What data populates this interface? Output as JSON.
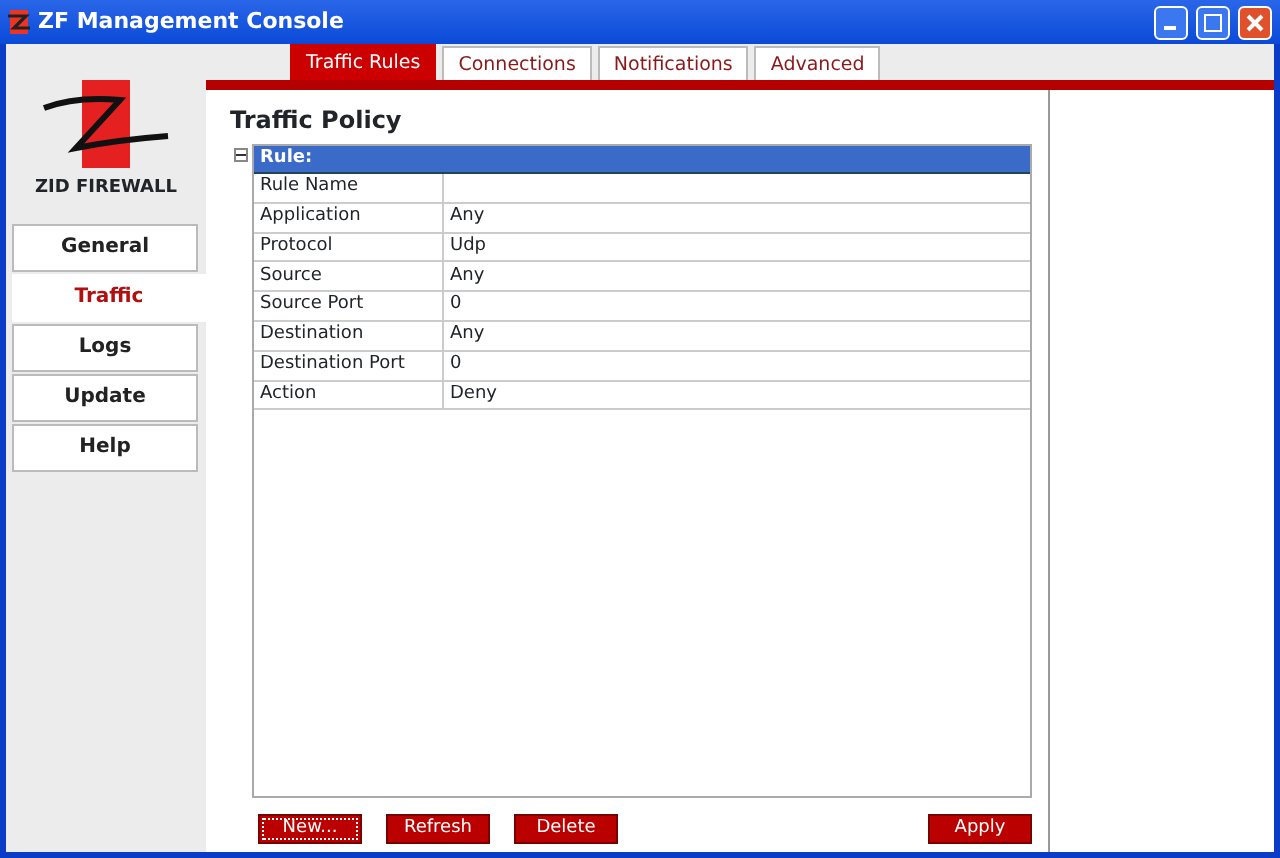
{
  "window": {
    "title": "ZF Management Console"
  },
  "logo": {
    "text": "ZID FIREWALL"
  },
  "sidebar": {
    "items": [
      {
        "label": "General",
        "selected": false
      },
      {
        "label": "Traffic",
        "selected": true
      },
      {
        "label": "Logs",
        "selected": false
      },
      {
        "label": "Update",
        "selected": false
      },
      {
        "label": "Help",
        "selected": false
      }
    ]
  },
  "tabs": [
    {
      "label": "Traffic Rules",
      "selected": true
    },
    {
      "label": "Connections",
      "selected": false
    },
    {
      "label": "Notifications",
      "selected": false
    },
    {
      "label": "Advanced",
      "selected": false
    }
  ],
  "panel": {
    "title": "Traffic Policy",
    "group": {
      "label": "Rule:",
      "expanded": true
    }
  },
  "table": {
    "rows": [
      {
        "name": "Rule Name",
        "value": ""
      },
      {
        "name": "Application",
        "value": "Any"
      },
      {
        "name": "Protocol",
        "value": "Udp"
      },
      {
        "name": "Source",
        "value": "Any"
      },
      {
        "name": "Source Port",
        "value": "0"
      },
      {
        "name": "Destination",
        "value": "Any"
      },
      {
        "name": "Destination Port",
        "value": "0"
      },
      {
        "name": "Action",
        "value": "Deny"
      }
    ]
  },
  "buttons": [
    {
      "label": "New...",
      "focused": true
    },
    {
      "label": "Refresh",
      "focused": false
    },
    {
      "label": "Delete",
      "focused": false
    }
  ],
  "apply_button": {
    "label": "Apply"
  }
}
